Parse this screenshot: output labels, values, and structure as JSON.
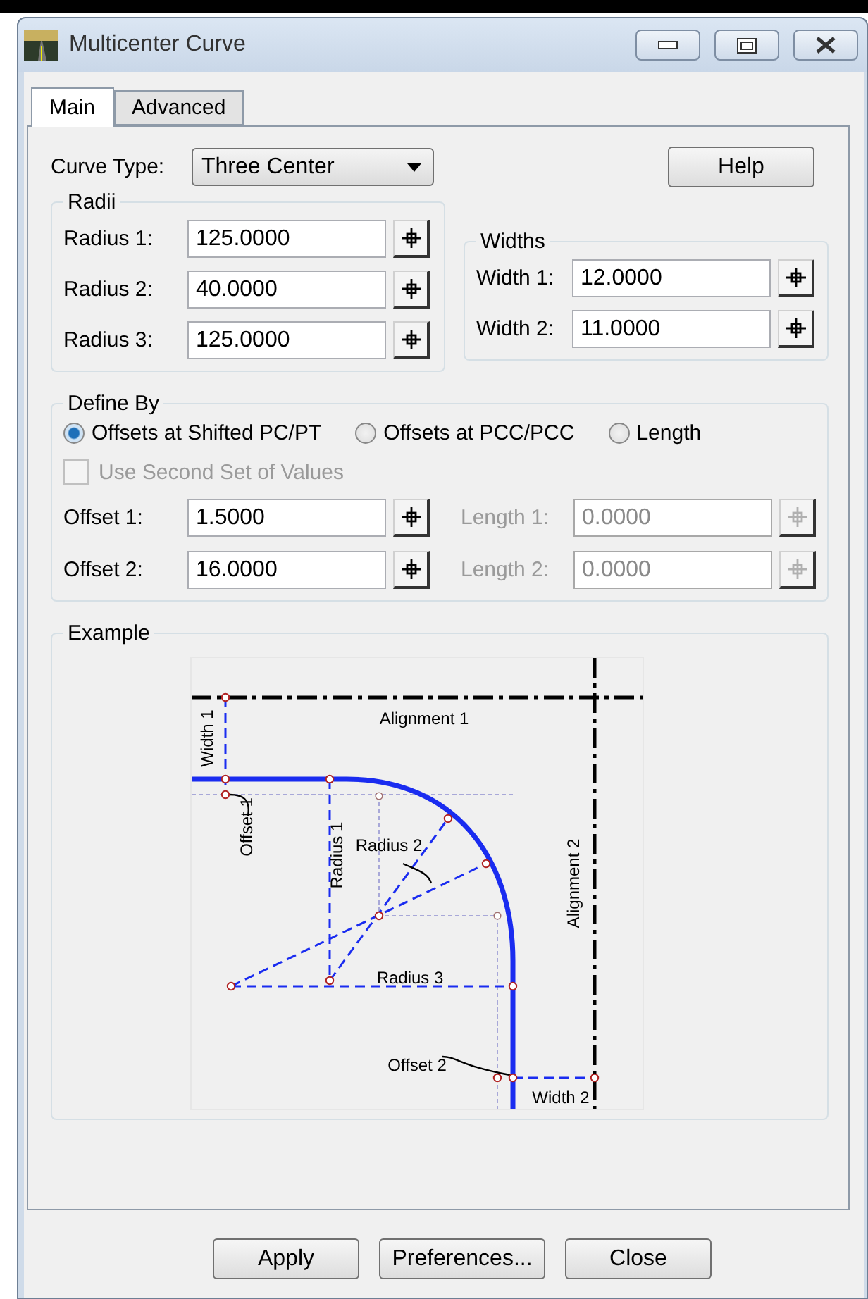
{
  "window": {
    "title": "Multicenter Curve"
  },
  "tabs": [
    {
      "label": "Main",
      "selected": true
    },
    {
      "label": "Advanced",
      "selected": false
    }
  ],
  "curve_type": {
    "label": "Curve Type:",
    "value": "Three Center"
  },
  "help_button": "Help",
  "radii": {
    "title": "Radii",
    "fields": [
      {
        "label": "Radius 1:",
        "value": "125.0000",
        "disabled": false
      },
      {
        "label": "Radius 2:",
        "value": "40.0000",
        "disabled": false
      },
      {
        "label": "Radius 3:",
        "value": "125.0000",
        "disabled": false
      }
    ]
  },
  "widths": {
    "title": "Widths",
    "fields": [
      {
        "label": "Width 1:",
        "value": "12.0000",
        "disabled": false
      },
      {
        "label": "Width 2:",
        "value": "11.0000",
        "disabled": false
      }
    ]
  },
  "define_by": {
    "title": "Define By",
    "options": [
      {
        "label": "Offsets at Shifted PC/PT",
        "selected": true
      },
      {
        "label": "Offsets at PCC/PCC",
        "selected": false
      },
      {
        "label": "Length",
        "selected": false
      }
    ],
    "checkbox": {
      "label": "Use Second Set of Values",
      "checked": false,
      "disabled": true
    },
    "offsets": [
      {
        "label": "Offset 1:",
        "value": "1.5000",
        "disabled": false
      },
      {
        "label": "Offset 2:",
        "value": "16.0000",
        "disabled": false
      }
    ],
    "lengths": [
      {
        "label": "Length 1:",
        "value": "0.0000",
        "disabled": true
      },
      {
        "label": "Length 2:",
        "value": "0.0000",
        "disabled": true
      }
    ]
  },
  "example": {
    "title": "Example",
    "labels": [
      "Alignment 1",
      "Width 1",
      "Offset 1",
      "Radius 1",
      "Radius 2",
      "Alignment 2",
      "Radius 3",
      "Offset 2",
      "Width 2"
    ]
  },
  "buttons": [
    "Apply",
    "Preferences...",
    "Close"
  ]
}
